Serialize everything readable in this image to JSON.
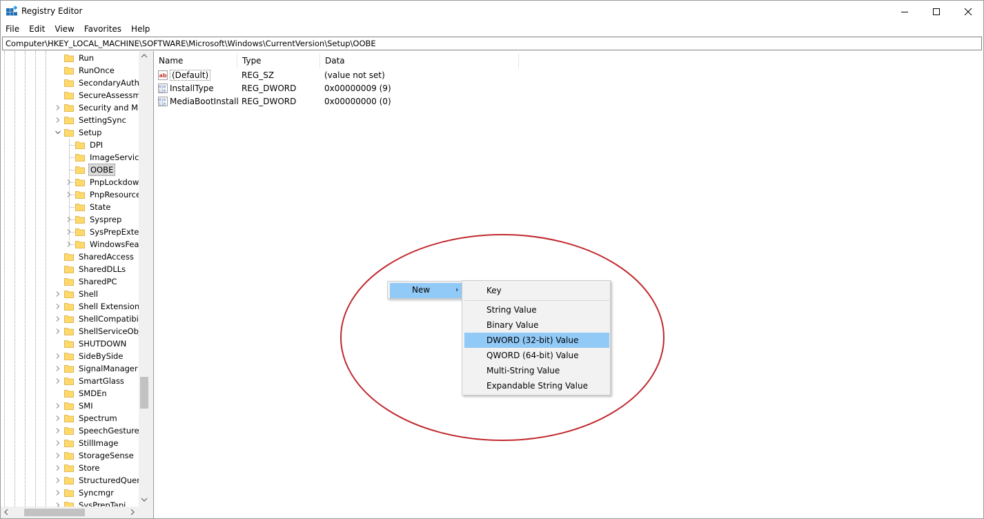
{
  "window": {
    "title": "Registry Editor",
    "controls": {
      "minimize": "minimize",
      "maximize": "maximize",
      "close": "close"
    }
  },
  "menu": [
    "File",
    "Edit",
    "View",
    "Favorites",
    "Help"
  ],
  "address": "Computer\\HKEY_LOCAL_MACHINE\\SOFTWARE\\Microsoft\\Windows\\CurrentVersion\\Setup\\OOBE",
  "tree": {
    "items": [
      {
        "label": "Run",
        "level": 1,
        "expander": false
      },
      {
        "label": "RunOnce",
        "level": 1,
        "expander": false
      },
      {
        "label": "SecondaryAuthF",
        "level": 1,
        "expander": false
      },
      {
        "label": "SecureAssessme",
        "level": 1,
        "expander": false
      },
      {
        "label": "Security and Ma",
        "level": 1,
        "expander": true
      },
      {
        "label": "SettingSync",
        "level": 1,
        "expander": true
      },
      {
        "label": "Setup",
        "level": 1,
        "expander": "open"
      },
      {
        "label": "DPI",
        "level": 2,
        "expander": false
      },
      {
        "label": "ImageServicir",
        "level": 2,
        "expander": false
      },
      {
        "label": "OOBE",
        "level": 2,
        "expander": false,
        "selected": true
      },
      {
        "label": "PnpLockdow",
        "level": 2,
        "expander": true
      },
      {
        "label": "PnpResource",
        "level": 2,
        "expander": true
      },
      {
        "label": "State",
        "level": 2,
        "expander": false
      },
      {
        "label": "Sysprep",
        "level": 2,
        "expander": true
      },
      {
        "label": "SysPrepExterr",
        "level": 2,
        "expander": true
      },
      {
        "label": "WindowsFeat",
        "level": 2,
        "expander": true
      },
      {
        "label": "SharedAccess",
        "level": 1,
        "expander": false
      },
      {
        "label": "SharedDLLs",
        "level": 1,
        "expander": false
      },
      {
        "label": "SharedPC",
        "level": 1,
        "expander": false
      },
      {
        "label": "Shell",
        "level": 1,
        "expander": true
      },
      {
        "label": "Shell Extensions",
        "level": 1,
        "expander": true
      },
      {
        "label": "ShellCompatibili",
        "level": 1,
        "expander": true
      },
      {
        "label": "ShellServiceObje",
        "level": 1,
        "expander": true
      },
      {
        "label": "SHUTDOWN",
        "level": 1,
        "expander": false
      },
      {
        "label": "SideBySide",
        "level": 1,
        "expander": true
      },
      {
        "label": "SignalManager",
        "level": 1,
        "expander": true
      },
      {
        "label": "SmartGlass",
        "level": 1,
        "expander": true
      },
      {
        "label": "SMDEn",
        "level": 1,
        "expander": false
      },
      {
        "label": "SMI",
        "level": 1,
        "expander": true
      },
      {
        "label": "Spectrum",
        "level": 1,
        "expander": true
      },
      {
        "label": "SpeechGestures",
        "level": 1,
        "expander": true
      },
      {
        "label": "StillImage",
        "level": 1,
        "expander": true
      },
      {
        "label": "StorageSense",
        "level": 1,
        "expander": true
      },
      {
        "label": "Store",
        "level": 1,
        "expander": true
      },
      {
        "label": "StructuredQuery",
        "level": 1,
        "expander": true
      },
      {
        "label": "Syncmgr",
        "level": 1,
        "expander": true
      },
      {
        "label": "SysPrepTapi",
        "level": 1,
        "expander": true
      }
    ]
  },
  "list": {
    "columns": [
      "Name",
      "Type",
      "Data"
    ],
    "rows": [
      {
        "name": "(Default)",
        "type": "REG_SZ",
        "data": "(value not set)",
        "icon": "string-value-icon"
      },
      {
        "name": "InstallType",
        "type": "REG_DWORD",
        "data": "0x00000009 (9)",
        "icon": "binary-value-icon"
      },
      {
        "name": "MediaBootInstall",
        "type": "REG_DWORD",
        "data": "0x00000000 (0)",
        "icon": "binary-value-icon"
      }
    ]
  },
  "context_menu": {
    "new_label": "New",
    "new_arrow": "›",
    "submenu": {
      "key": "Key",
      "items": [
        "String Value",
        "Binary Value",
        "DWORD (32-bit) Value",
        "QWORD (64-bit) Value",
        "Multi-String Value",
        "Expandable String Value"
      ],
      "highlighted": "DWORD (32-bit) Value"
    }
  },
  "colors": {
    "highlight": "#91c9f7",
    "annotation_ellipse": "#c0272d",
    "folder": "#ffd96b"
  }
}
